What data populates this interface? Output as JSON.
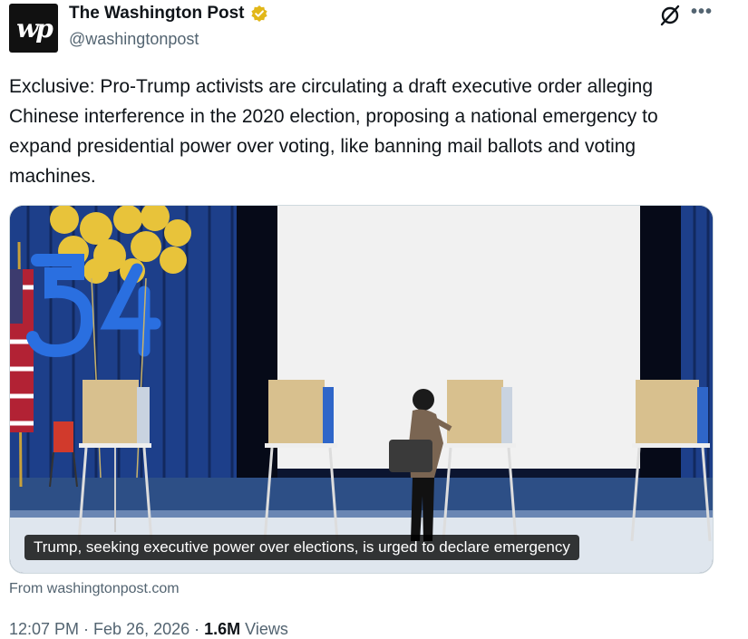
{
  "author": {
    "display_name": "The Washington Post",
    "handle": "@washingtonpost",
    "avatar_text": "wp",
    "verified_color": "#e2b719"
  },
  "actions": {
    "grok_icon": "grok-icon",
    "more_label": "•••"
  },
  "tweet": {
    "text": "Exclusive: Pro-Trump activists are circulating a draft executive order alleging Chinese interference in the 2020 election, proposing a national emergency to expand presidential power over voting, like banning mail ballots and voting machines."
  },
  "media": {
    "caption": "Trump, seeking executive power over elections, is urged to declare emergency",
    "source": "From washingtonpost.com"
  },
  "meta": {
    "time": "12:07 PM",
    "sep1": " · ",
    "date": "Feb 26, 2026",
    "sep2": " · ",
    "views_count": "1.6M",
    "views_label": " Views"
  },
  "colors": {
    "text": "#0f1419",
    "secondary": "#536471",
    "curtain": "#1d3f8a"
  }
}
